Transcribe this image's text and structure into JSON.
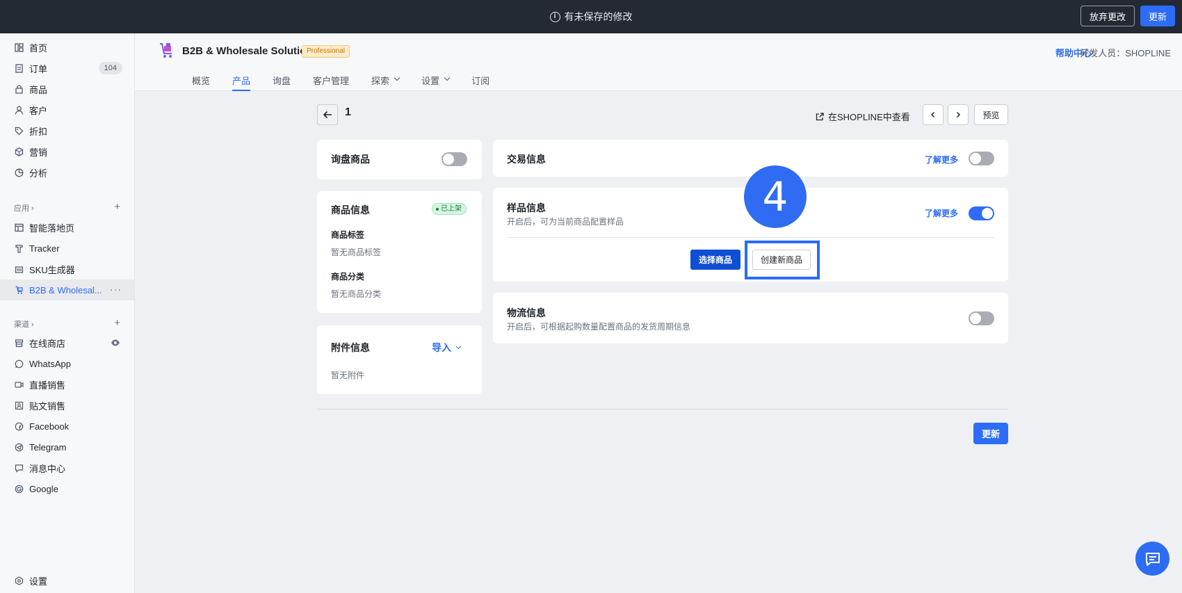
{
  "topbar": {
    "unsaved_text": "有未保存的修改",
    "discard_label": "放弃更改",
    "update_label": "更新"
  },
  "sidebar": {
    "main_items": [
      {
        "label": "首页",
        "icon": "dashboard-icon"
      },
      {
        "label": "订单",
        "icon": "order-icon",
        "count": "104"
      },
      {
        "label": "商品",
        "icon": "bag-icon"
      },
      {
        "label": "客户",
        "icon": "user-icon"
      },
      {
        "label": "折扣",
        "icon": "tag-icon"
      },
      {
        "label": "营销",
        "icon": "cube-icon"
      },
      {
        "label": "分析",
        "icon": "chart-icon"
      }
    ],
    "apps_label": "应用",
    "apps": [
      {
        "label": "智能落地页"
      },
      {
        "label": "Tracker"
      },
      {
        "label": "SKU生成器"
      },
      {
        "label": "B2B & Wholesal..."
      }
    ],
    "channels_label": "渠道",
    "channels": [
      {
        "label": "在线商店"
      },
      {
        "label": "WhatsApp"
      },
      {
        "label": "直播销售"
      },
      {
        "label": "贴文销售"
      },
      {
        "label": "Facebook"
      },
      {
        "label": "Telegram"
      },
      {
        "label": "消息中心"
      },
      {
        "label": "Google"
      }
    ],
    "settings_label": "设置"
  },
  "app_header": {
    "title": "B2B & Wholesale Solution",
    "plan_badge": "Professional",
    "help_link": "帮助中心",
    "developer_text": "开发人员：SHOPLINE",
    "tabs": [
      {
        "label": "概览"
      },
      {
        "label": "产品",
        "active": true
      },
      {
        "label": "询盘"
      },
      {
        "label": "客户管理"
      },
      {
        "label": "探索",
        "dropdown": true
      },
      {
        "label": "设置",
        "dropdown": true
      },
      {
        "label": "订阅"
      }
    ]
  },
  "page": {
    "title": "1",
    "view_in_shopline": "在SHOPLINE中查看",
    "preview_label": "预览",
    "update_label": "更新"
  },
  "inquiry_card": {
    "title": "询盘商品",
    "enabled": false
  },
  "product_info_card": {
    "title": "商品信息",
    "status": "已上架",
    "tags_label": "商品标签",
    "tags_empty": "暂无商品标签",
    "category_label": "商品分类",
    "category_empty": "暂无商品分类"
  },
  "attachment_card": {
    "title": "附件信息",
    "import_label": "导入",
    "empty": "暂无附件"
  },
  "trade_card": {
    "title": "交易信息",
    "learn_more": "了解更多",
    "enabled": false
  },
  "sample_card": {
    "title": "样品信息",
    "description": "开启后，可为当前商品配置样品",
    "learn_more": "了解更多",
    "enabled": true,
    "select_label": "选择商品",
    "create_label": "创建新商品"
  },
  "logistics_card": {
    "title": "物流信息",
    "description": "开启后，可根据起购数量配置商品的发货周期信息",
    "enabled": false
  },
  "annotation": {
    "step_number": "4",
    "color": "#2a6cf0"
  }
}
